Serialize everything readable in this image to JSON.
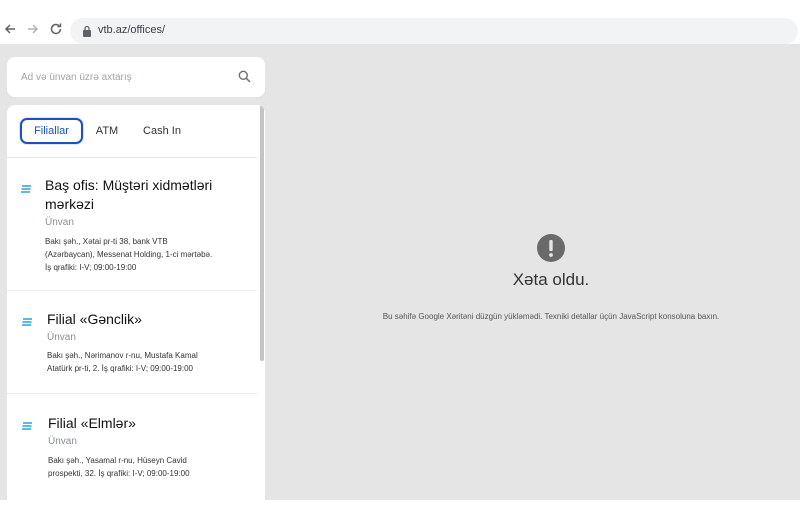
{
  "browser": {
    "url": "vtb.az/offices/"
  },
  "search": {
    "placeholder": "Ad və ünvan üzrə axtarış"
  },
  "tabs": [
    {
      "label": "Filiallar",
      "active": true
    },
    {
      "label": "ATM",
      "active": false
    },
    {
      "label": "Cash In",
      "active": false
    }
  ],
  "offices": [
    {
      "title_line1": "Baş ofis: Müştəri xidmətləri",
      "title_line2": "mərkəzi",
      "subtitle": "Ünvan",
      "addr_line1": "Bakı şəh., Xətai pr-ti 38, bank VTB",
      "addr_line2": "(Azərbaycan), Messenat Holding, 1-ci mərtəbə.",
      "addr_line3": "İş qrafiki: I-V; 09:00-19:00"
    },
    {
      "title_line1": "Filial «Gənclik»",
      "subtitle": "Ünvan",
      "addr_line1": "Bakı şəh., Nərimanov r-nu, Mustafa Kamal",
      "addr_line2": "Atatürk pr-ti, 2. İş qrafiki: I-V; 09:00-19:00"
    },
    {
      "title_line1": "Filial «Elmlər»",
      "subtitle": "Ünvan",
      "addr_line1": "Bakı şəh., Yasamal r-nu, Hüseyn Cavid",
      "addr_line2": "prospekti, 32. İş qrafiki: I-V; 09:00-19:00"
    }
  ],
  "map_error": {
    "title": "Xəta oldu.",
    "message": "Bu səhifə Google Xəritəni düzgün yükləmədi. Texniki detallar üçün JavaScript konsoluna baxın."
  },
  "colors": {
    "accent": "#1c4fbf",
    "office_icon": "#2a9fd8",
    "map_bg": "#e5e5e5"
  }
}
